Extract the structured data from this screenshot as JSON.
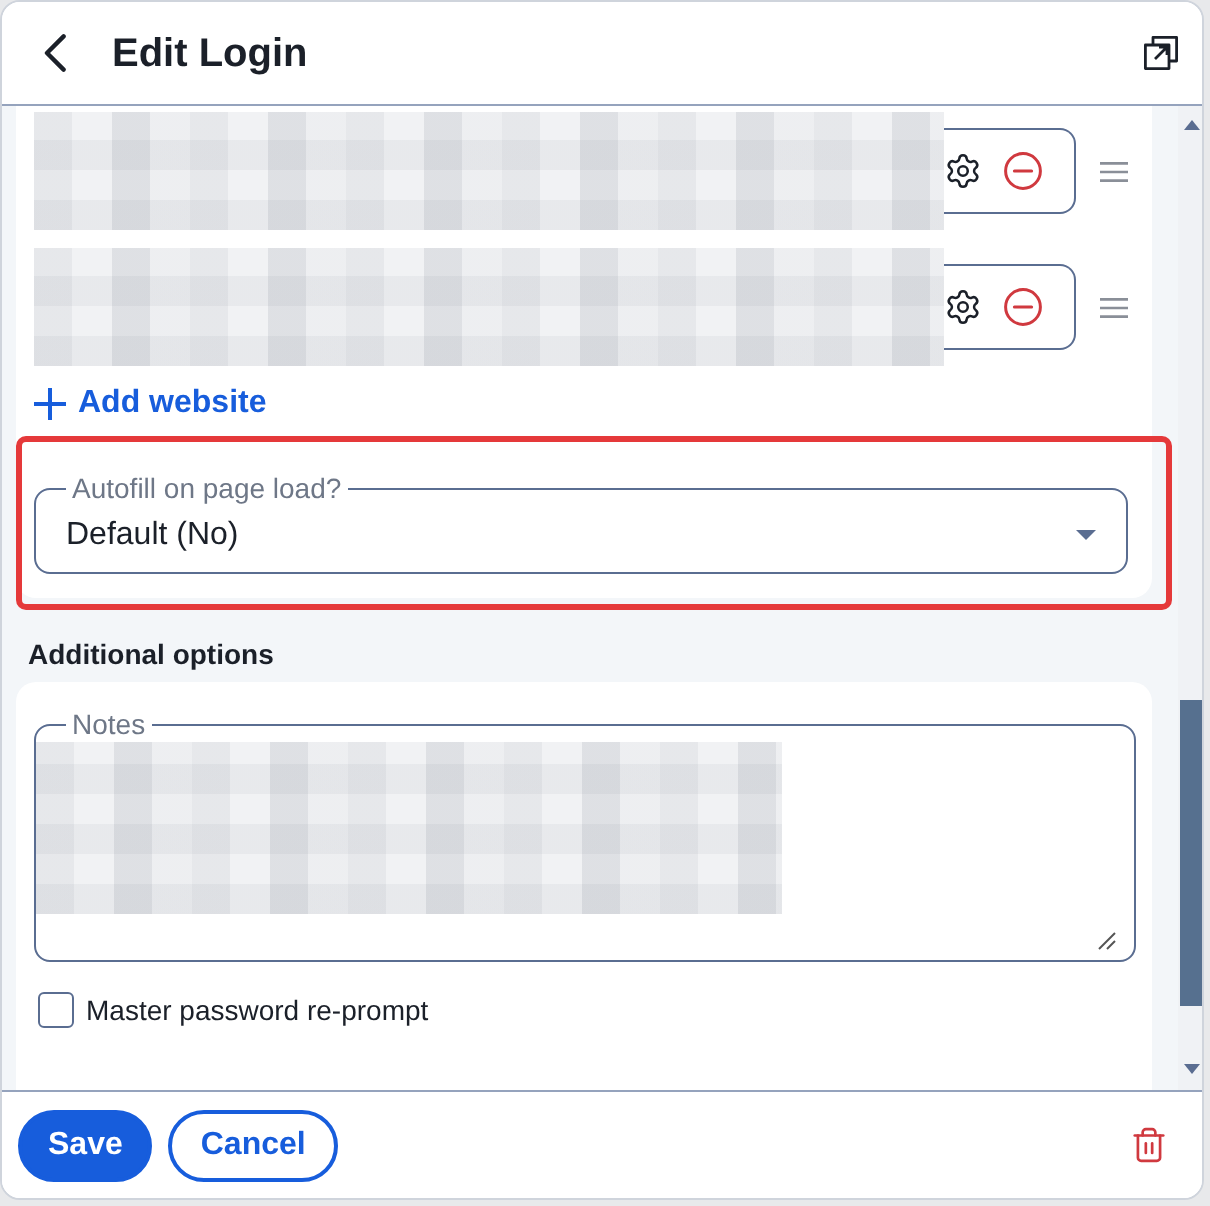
{
  "header": {
    "title": "Edit Login"
  },
  "websites": [
    {
      "redacted": true
    },
    {
      "redacted": true
    }
  ],
  "add_website": {
    "label": "Add website"
  },
  "autofill": {
    "label": "Autofill on page load?",
    "value": "Default (No)",
    "highlighted": true
  },
  "additional_options": {
    "title": "Additional options",
    "notes": {
      "label": "Notes",
      "redacted": true
    },
    "reprompt": {
      "label": "Master password re-prompt",
      "checked": false
    }
  },
  "footer": {
    "buttons": [
      {
        "label": "Save",
        "kind": "primary"
      },
      {
        "label": "Cancel",
        "kind": "secondary"
      }
    ]
  }
}
